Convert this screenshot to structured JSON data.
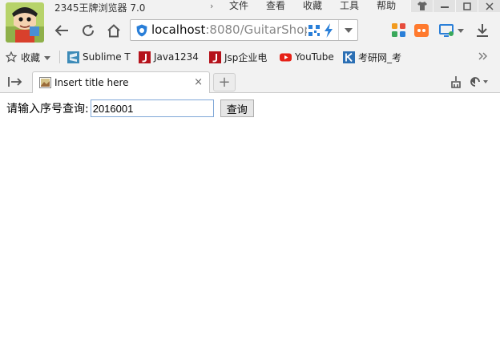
{
  "window": {
    "app_title": "2345王牌浏览器 7.0",
    "menu": [
      "文件",
      "查看",
      "收藏",
      "工具",
      "帮助"
    ]
  },
  "address_bar": {
    "host": "localhost",
    "port_path": ":8080/GuitarShop"
  },
  "bookmarks": {
    "favorites_label": "收藏",
    "items": [
      {
        "label": "Sublime T",
        "icon": "sublime-icon"
      },
      {
        "label": "Java1234",
        "icon": "java-j-icon"
      },
      {
        "label": "Jsp企业电",
        "icon": "java-j-icon"
      },
      {
        "label": "YouTube",
        "icon": "youtube-icon"
      },
      {
        "label": "考研网_考",
        "icon": "kaoyan-icon"
      }
    ]
  },
  "tabs": [
    {
      "title": "Insert title here",
      "active": true
    }
  ],
  "page": {
    "query_label": "请输入序号查询:",
    "query_value": "2016001",
    "query_button": "查询"
  },
  "colors": {
    "chrome_bg": "#f2f2f2",
    "accent_blue": "#2a7fd8",
    "java_red": "#b5121b",
    "youtube_red": "#e62117"
  }
}
